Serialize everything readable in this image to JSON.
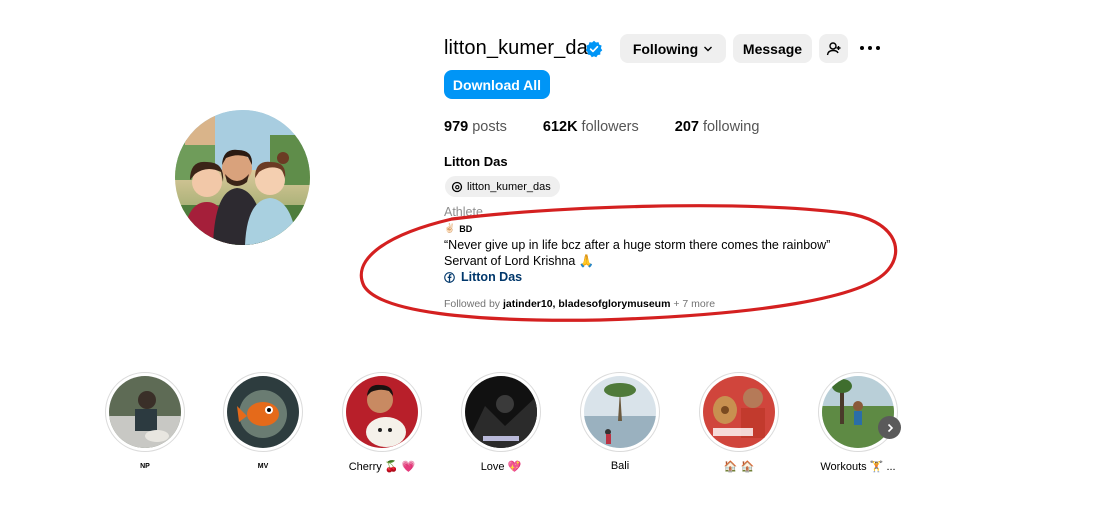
{
  "profile": {
    "username": "litton_kumer_das",
    "following_label": "Following",
    "message_label": "Message",
    "download_label": "Download All",
    "stats": [
      {
        "value": "979",
        "label": "posts"
      },
      {
        "value": "612K",
        "label": "followers"
      },
      {
        "value": "207",
        "label": "following"
      }
    ],
    "full_name": "Litton Das",
    "threads_handle": "litton_kumer_das",
    "category": "Athlete",
    "bd_emoji": "✌🏻",
    "bd_text": "BD",
    "bio_line1": "“Never give up in life bcz after a huge storm there comes the rainbow”",
    "bio_line2": "Servant of Lord Krishna 🙏",
    "link_text": "Litton Das",
    "followed_by_prefix": "Followed by",
    "followed_by_names": "jatinder10, bladesofglorymuseum",
    "followed_by_more": "+ 7 more"
  },
  "highlights": [
    {
      "label": "NP"
    },
    {
      "label": "MV"
    },
    {
      "label": "Cherry 🍒 💗"
    },
    {
      "label": "Love 💖"
    },
    {
      "label": "Bali"
    },
    {
      "label": "🏠 🏠"
    },
    {
      "label": "Workouts 🏋 ..."
    }
  ],
  "icons": {
    "verified": "verified-badge-icon",
    "following_chevron": "chevron-down-icon",
    "add_user": "add-user-icon",
    "more": "more-options-icon",
    "threads": "threads-icon",
    "facebook": "facebook-icon",
    "next": "chevron-right-icon"
  },
  "colors": {
    "primary": "#0095f6",
    "button_gray": "#efefef",
    "annotation_red": "#d42020",
    "link": "#00376b"
  }
}
